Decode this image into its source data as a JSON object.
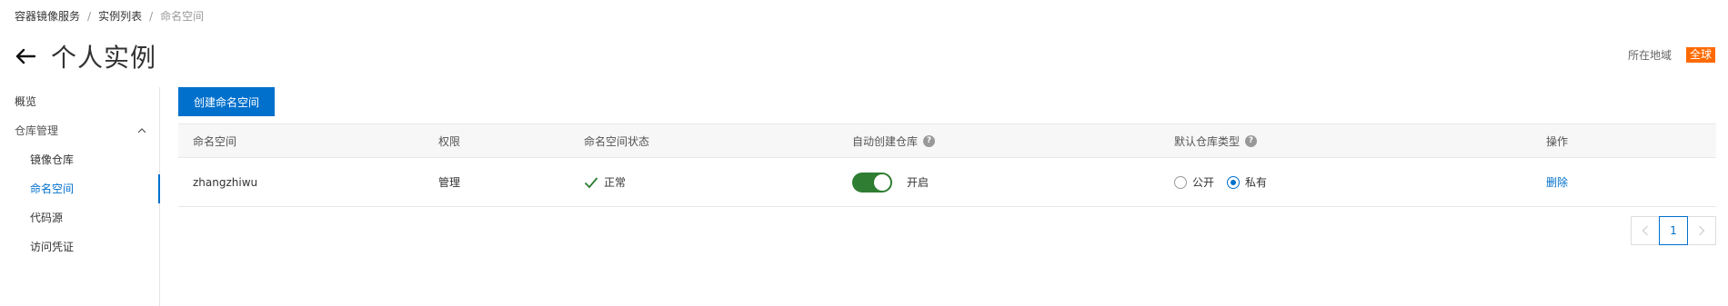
{
  "breadcrumb": {
    "items": [
      "容器镜像服务",
      "实例列表",
      "命名空间"
    ],
    "separator": "/"
  },
  "header": {
    "title": "个人实例",
    "back_icon": "arrow-left-icon"
  },
  "region": {
    "label": "所在地域",
    "value": "全球",
    "badge_color": "#ff6a00"
  },
  "sidebar": {
    "overview": "概览",
    "group_label": "仓库管理",
    "items": [
      "镜像仓库",
      "命名空间",
      "代码源",
      "访问凭证"
    ],
    "active_item": "命名空间"
  },
  "toolbar": {
    "create_label": "创建命名空间"
  },
  "table": {
    "columns": [
      "命名空间",
      "权限",
      "命名空间状态",
      "自动创建仓库",
      "默认仓库类型",
      "操作"
    ],
    "rows": [
      {
        "namespace": "zhangzhiwu",
        "permission": "管理",
        "status": "正常",
        "auto_create_label": "开启",
        "auto_create_on": true,
        "repo_type_options": [
          "公开",
          "私有"
        ],
        "repo_type_selected": "私有",
        "action": "删除"
      }
    ]
  },
  "pagination": {
    "current_page": "1"
  },
  "colors": {
    "primary": "#0070cc",
    "success": "#2e7d32",
    "accent": "#ff6a00"
  }
}
